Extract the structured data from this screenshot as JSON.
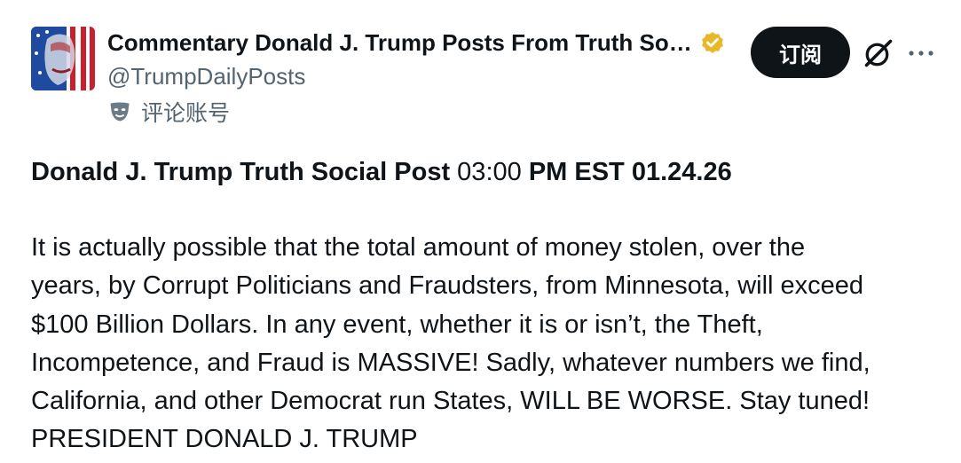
{
  "header": {
    "display_name": "Commentary Donald J. Trump Posts From Truth So…",
    "handle": "@TrumpDailyPosts",
    "account_label": "评论账号",
    "subscribe_label": "订阅",
    "verified_color": "#e8b829"
  },
  "icons": {
    "avatar": "avatar-image",
    "verified": "verified-badge-icon",
    "mask": "parody-mask-icon",
    "grok": "grok-icon",
    "more": "more-options-icon"
  },
  "post": {
    "title_bold_1": "Donald J. Trump Truth Social Post",
    "title_time": " 03:00 ",
    "title_bold_2": "PM EST 01.24.26",
    "body_lines": [
      "It is actually possible that the total amount of money stolen, over the",
      "years, by Corrupt Politicians and Fraudsters, from Minnesota, will exceed",
      "$100 Billion Dollars. In any event, whether it is or isn’t, the Theft,",
      "Incompetence, and Fraud is MASSIVE! Sadly, whatever numbers we find,",
      "California, and other Democrat run States, WILL BE WORSE. Stay tuned!",
      "PRESIDENT DONALD J. TRUMP"
    ]
  }
}
